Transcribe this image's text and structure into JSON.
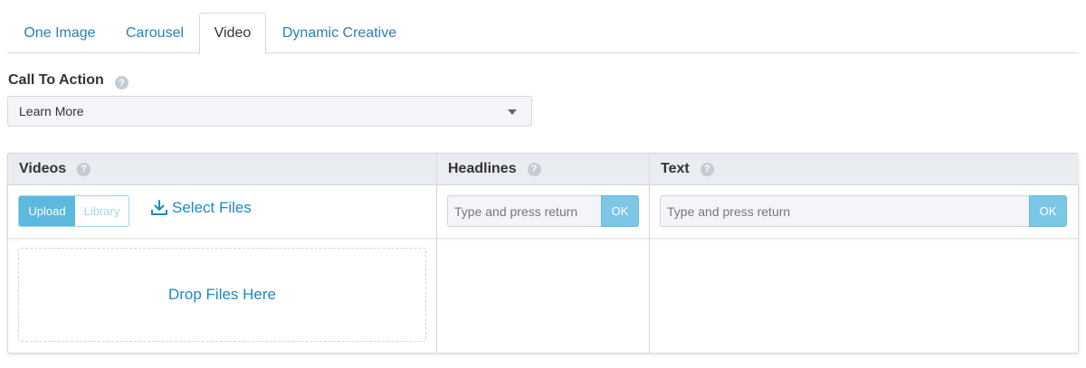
{
  "tabs": [
    {
      "label": "One Image"
    },
    {
      "label": "Carousel"
    },
    {
      "label": "Video"
    },
    {
      "label": "Dynamic Creative"
    }
  ],
  "active_tab": "Video",
  "cta": {
    "label": "Call To Action",
    "help": "?",
    "selected": "Learn More"
  },
  "columns": {
    "videos": {
      "title": "Videos",
      "help": "?",
      "upload_label": "Upload",
      "library_label": "Library",
      "select_files_label": "Select Files",
      "dropzone_label": "Drop Files Here"
    },
    "headlines": {
      "title": "Headlines",
      "help": "?",
      "placeholder": "Type and press return",
      "ok_label": "OK"
    },
    "text": {
      "title": "Text",
      "help": "?",
      "placeholder": "Type and press return",
      "ok_label": "OK"
    }
  },
  "colors": {
    "link_blue": "#2a7fb8",
    "button_blue": "#5cb8dd",
    "ok_blue": "#7cc6e6",
    "header_gray": "#e9ecf0"
  }
}
